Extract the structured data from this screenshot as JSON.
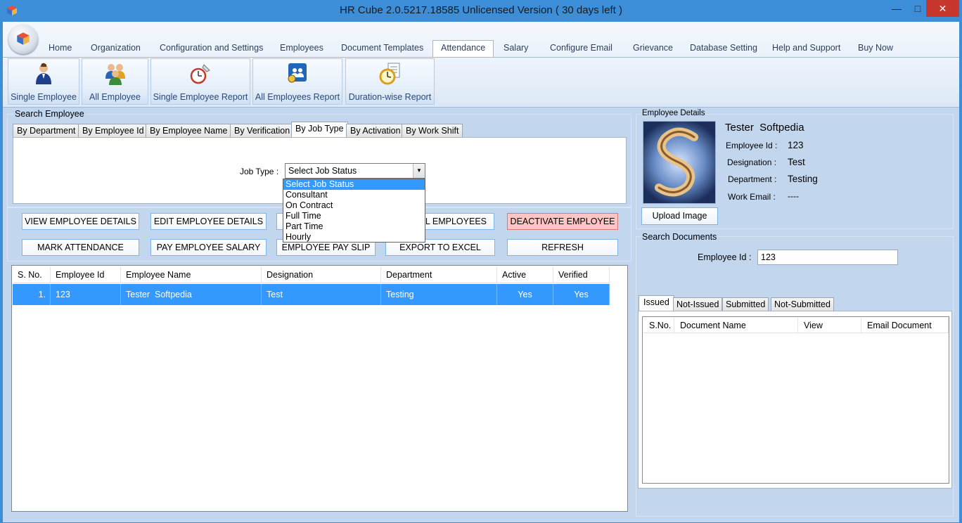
{
  "window": {
    "title": "HR Cube 2.0.5217.18585 Unlicensed Version ( 30 days left )",
    "minimize": "—",
    "maximize": "□",
    "close": "✕"
  },
  "ribbon": {
    "tabs": [
      "Home",
      "Organization",
      "Configuration and Settings",
      "Employees",
      "Document Templates",
      "Attendance",
      "Salary",
      "Configure Email",
      "Grievance",
      "Database Setting",
      "Help and Support",
      "Buy Now"
    ],
    "active_tab": "Attendance",
    "buttons": [
      {
        "label": "Single Employee",
        "icon": "single-employee-icon"
      },
      {
        "label": "All Employee",
        "icon": "all-employee-icon"
      },
      {
        "label": "Single Employee Report",
        "icon": "single-report-icon"
      },
      {
        "label": "All Employees Report",
        "icon": "all-report-icon"
      },
      {
        "label": "Duration-wise Report",
        "icon": "duration-report-icon"
      }
    ]
  },
  "search": {
    "group_label": "Search Employee",
    "tabs": [
      "By Department",
      "By Employee Id",
      "By Employee Name",
      "By Verification",
      "By Job Type",
      "By Activation",
      "By Work Shift"
    ],
    "active_tab": "By Job Type",
    "job_type_label": "Job Type :",
    "job_type_value": "Select Job Status",
    "job_type_options": [
      "Select Job Status",
      "Consultant",
      "On Contract",
      "Full Time",
      "Part Time",
      "Hourly"
    ]
  },
  "actions": {
    "view": "VIEW EMPLOYEE DETAILS",
    "edit": "EDIT EMPLOYEE DETAILS",
    "all": "L EMPLOYEES",
    "deactivate": "DEACTIVATE EMPLOYEE",
    "attendance": "MARK ATTENDANCE",
    "salary": "PAY EMPLOYEE SALARY",
    "payslip": "EMPLOYEE PAY SLIP",
    "export": "EXPORT TO EXCEL",
    "refresh": "REFRESH"
  },
  "employees": {
    "columns": [
      "S. No.",
      "Employee Id",
      "Employee Name",
      "Designation",
      "Department",
      "Active",
      "Verified"
    ],
    "rows": [
      {
        "sno": "1.",
        "id": "123",
        "name": "Tester  Softpedia",
        "designation": "Test",
        "department": "Testing",
        "active": "Yes",
        "verified": "Yes"
      }
    ]
  },
  "details": {
    "group_label": "Employee Details",
    "name": "Tester  Softpedia",
    "id_label": "Employee Id :",
    "id": "123",
    "designation_label": "Designation :",
    "designation": "Test",
    "department_label": "Department :",
    "department": "Testing",
    "email_label": "Work Email :",
    "email": "----",
    "upload": "Upload Image"
  },
  "documents": {
    "group_label": "Search Documents",
    "id_label": "Employee Id :",
    "id_value": "123",
    "tabs": [
      "Issued",
      "Not-Issued",
      "Submitted",
      "Not-Submitted"
    ],
    "active_tab": "Issued",
    "columns": [
      "S.No.",
      "Document Name",
      "View",
      "Email Document"
    ]
  }
}
